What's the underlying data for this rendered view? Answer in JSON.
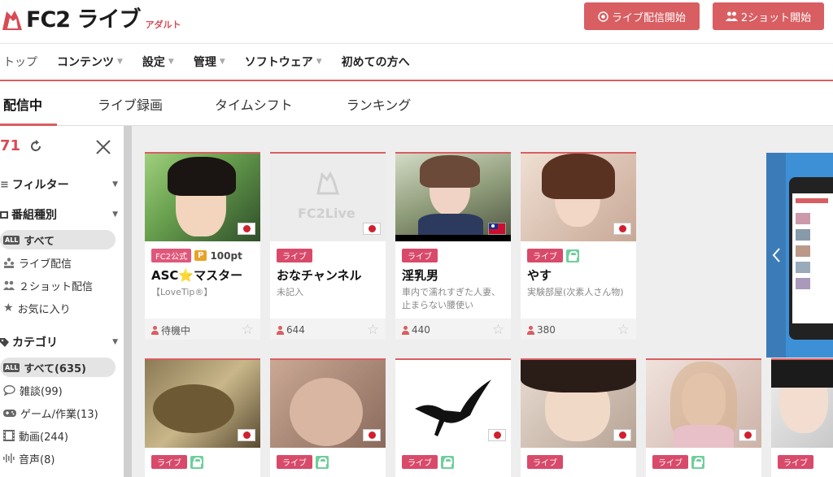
{
  "header": {
    "logo_text": "FC2 ライブ",
    "logo_sub": "アダルト",
    "btn_live_start": "ライブ配信開始",
    "btn_2shot_start": "2ショット開始"
  },
  "nav": {
    "items": [
      {
        "label": "トップ",
        "caret": false
      },
      {
        "label": "コンテンツ",
        "caret": true
      },
      {
        "label": "設定",
        "caret": true
      },
      {
        "label": "管理",
        "caret": true
      },
      {
        "label": "ソフトウェア",
        "caret": true
      },
      {
        "label": "初めての方へ",
        "caret": false
      }
    ]
  },
  "tabs": [
    "配信中",
    "ライブ録画",
    "タイムシフト",
    "ランキング"
  ],
  "sidebar": {
    "count": "71",
    "filter_label": "フィルター",
    "program_type_label": "番組種別",
    "program_items": [
      "すべて",
      "ライブ配信",
      "２ショット配信",
      "お気に入り"
    ],
    "category_label": "カテゴリ",
    "category_items": [
      "すべて(635)",
      "雑談(99)",
      "ゲーム/作業(13)",
      "動画(244)",
      "音声(8)"
    ],
    "all_badge": "ALL"
  },
  "cards": [
    {
      "badges": [
        "FC2公式",
        "P",
        "100pt"
      ],
      "title": "ASC⭐マスター",
      "desc": "【LoveTip®】",
      "viewers": "待機中",
      "flag": "jp",
      "lock": false
    },
    {
      "badges": [
        "ライブ"
      ],
      "title": "おなチャンネル",
      "desc": "未記入",
      "viewers": "644",
      "flag": "jp",
      "lock": false,
      "placeholder_text": "FC2Live"
    },
    {
      "badges": [
        "ライブ"
      ],
      "title": "淫乳男",
      "desc": "車内で濡れすぎた人妻、止まらない腰使い",
      "viewers": "440",
      "flag": "tw",
      "lock": false
    },
    {
      "badges": [
        "ライブ"
      ],
      "title": "やす",
      "desc": "実験部屋(次素人さん物)",
      "viewers": "380",
      "flag": "jp",
      "lock": true
    },
    {
      "badges": [
        "ライブ"
      ],
      "title": "",
      "flag": "jp",
      "lock": true
    },
    {
      "badges": [
        "ライブ"
      ],
      "title": "",
      "flag": "jp",
      "lock": true
    },
    {
      "badges": [
        "ライブ"
      ],
      "title": "",
      "flag": "jp",
      "lock": true
    },
    {
      "badges": [
        "ライブ"
      ],
      "title": "",
      "flag": "jp",
      "lock": true
    },
    {
      "badges": [
        "ライブ"
      ],
      "title": "",
      "flag": "jp",
      "lock": true
    },
    {
      "badges": [
        "ライブ"
      ],
      "title": "",
      "flag": "jp",
      "lock": true
    }
  ],
  "colors": {
    "accent": "#d95e62",
    "live_badge": "#d94a6a",
    "count": "#d94a55"
  }
}
